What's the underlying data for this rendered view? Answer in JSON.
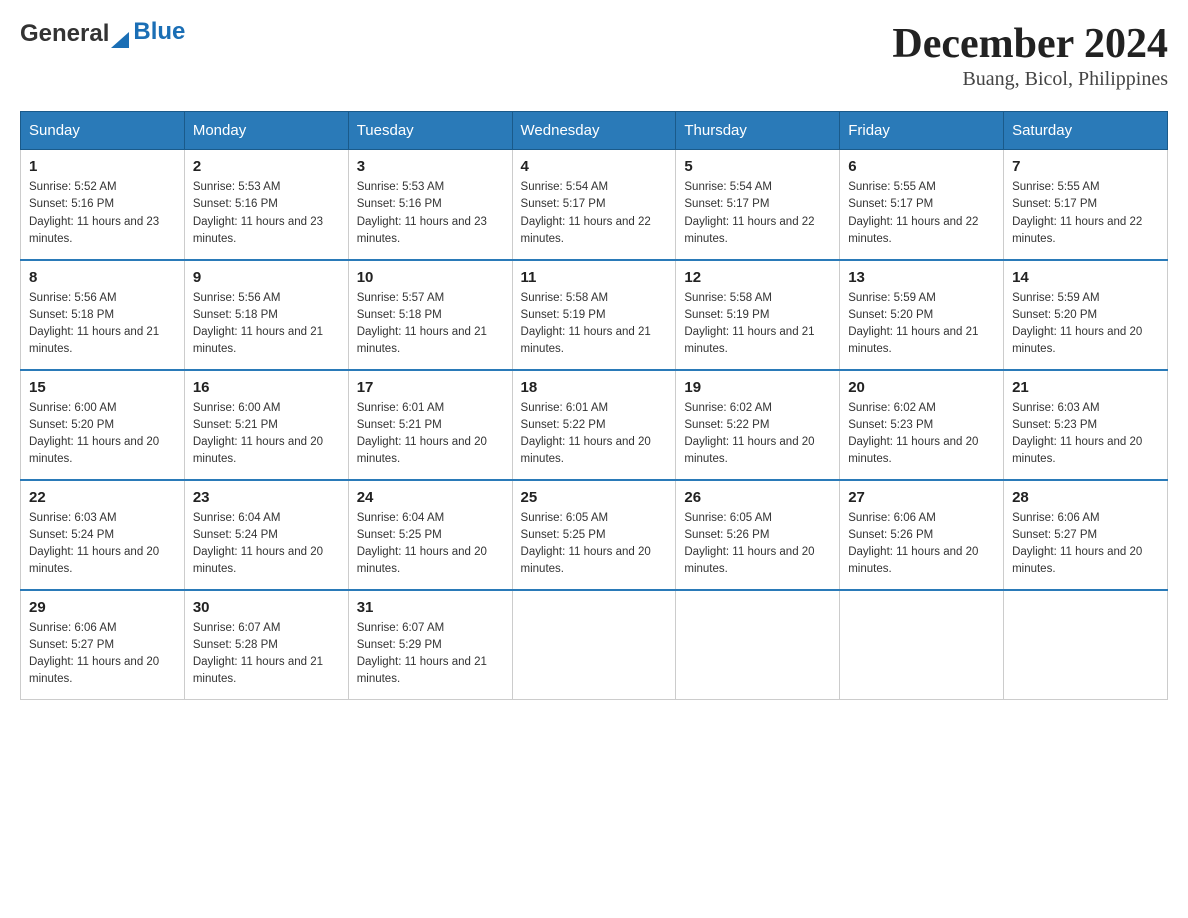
{
  "logo": {
    "text_general": "General",
    "text_blue": "Blue"
  },
  "header": {
    "month": "December 2024",
    "location": "Buang, Bicol, Philippines"
  },
  "days_of_week": [
    "Sunday",
    "Monday",
    "Tuesday",
    "Wednesday",
    "Thursday",
    "Friday",
    "Saturday"
  ],
  "weeks": [
    [
      {
        "day": "1",
        "sunrise": "5:52 AM",
        "sunset": "5:16 PM",
        "daylight": "11 hours and 23 minutes."
      },
      {
        "day": "2",
        "sunrise": "5:53 AM",
        "sunset": "5:16 PM",
        "daylight": "11 hours and 23 minutes."
      },
      {
        "day": "3",
        "sunrise": "5:53 AM",
        "sunset": "5:16 PM",
        "daylight": "11 hours and 23 minutes."
      },
      {
        "day": "4",
        "sunrise": "5:54 AM",
        "sunset": "5:17 PM",
        "daylight": "11 hours and 22 minutes."
      },
      {
        "day": "5",
        "sunrise": "5:54 AM",
        "sunset": "5:17 PM",
        "daylight": "11 hours and 22 minutes."
      },
      {
        "day": "6",
        "sunrise": "5:55 AM",
        "sunset": "5:17 PM",
        "daylight": "11 hours and 22 minutes."
      },
      {
        "day": "7",
        "sunrise": "5:55 AM",
        "sunset": "5:17 PM",
        "daylight": "11 hours and 22 minutes."
      }
    ],
    [
      {
        "day": "8",
        "sunrise": "5:56 AM",
        "sunset": "5:18 PM",
        "daylight": "11 hours and 21 minutes."
      },
      {
        "day": "9",
        "sunrise": "5:56 AM",
        "sunset": "5:18 PM",
        "daylight": "11 hours and 21 minutes."
      },
      {
        "day": "10",
        "sunrise": "5:57 AM",
        "sunset": "5:18 PM",
        "daylight": "11 hours and 21 minutes."
      },
      {
        "day": "11",
        "sunrise": "5:58 AM",
        "sunset": "5:19 PM",
        "daylight": "11 hours and 21 minutes."
      },
      {
        "day": "12",
        "sunrise": "5:58 AM",
        "sunset": "5:19 PM",
        "daylight": "11 hours and 21 minutes."
      },
      {
        "day": "13",
        "sunrise": "5:59 AM",
        "sunset": "5:20 PM",
        "daylight": "11 hours and 21 minutes."
      },
      {
        "day": "14",
        "sunrise": "5:59 AM",
        "sunset": "5:20 PM",
        "daylight": "11 hours and 20 minutes."
      }
    ],
    [
      {
        "day": "15",
        "sunrise": "6:00 AM",
        "sunset": "5:20 PM",
        "daylight": "11 hours and 20 minutes."
      },
      {
        "day": "16",
        "sunrise": "6:00 AM",
        "sunset": "5:21 PM",
        "daylight": "11 hours and 20 minutes."
      },
      {
        "day": "17",
        "sunrise": "6:01 AM",
        "sunset": "5:21 PM",
        "daylight": "11 hours and 20 minutes."
      },
      {
        "day": "18",
        "sunrise": "6:01 AM",
        "sunset": "5:22 PM",
        "daylight": "11 hours and 20 minutes."
      },
      {
        "day": "19",
        "sunrise": "6:02 AM",
        "sunset": "5:22 PM",
        "daylight": "11 hours and 20 minutes."
      },
      {
        "day": "20",
        "sunrise": "6:02 AM",
        "sunset": "5:23 PM",
        "daylight": "11 hours and 20 minutes."
      },
      {
        "day": "21",
        "sunrise": "6:03 AM",
        "sunset": "5:23 PM",
        "daylight": "11 hours and 20 minutes."
      }
    ],
    [
      {
        "day": "22",
        "sunrise": "6:03 AM",
        "sunset": "5:24 PM",
        "daylight": "11 hours and 20 minutes."
      },
      {
        "day": "23",
        "sunrise": "6:04 AM",
        "sunset": "5:24 PM",
        "daylight": "11 hours and 20 minutes."
      },
      {
        "day": "24",
        "sunrise": "6:04 AM",
        "sunset": "5:25 PM",
        "daylight": "11 hours and 20 minutes."
      },
      {
        "day": "25",
        "sunrise": "6:05 AM",
        "sunset": "5:25 PM",
        "daylight": "11 hours and 20 minutes."
      },
      {
        "day": "26",
        "sunrise": "6:05 AM",
        "sunset": "5:26 PM",
        "daylight": "11 hours and 20 minutes."
      },
      {
        "day": "27",
        "sunrise": "6:06 AM",
        "sunset": "5:26 PM",
        "daylight": "11 hours and 20 minutes."
      },
      {
        "day": "28",
        "sunrise": "6:06 AM",
        "sunset": "5:27 PM",
        "daylight": "11 hours and 20 minutes."
      }
    ],
    [
      {
        "day": "29",
        "sunrise": "6:06 AM",
        "sunset": "5:27 PM",
        "daylight": "11 hours and 20 minutes."
      },
      {
        "day": "30",
        "sunrise": "6:07 AM",
        "sunset": "5:28 PM",
        "daylight": "11 hours and 21 minutes."
      },
      {
        "day": "31",
        "sunrise": "6:07 AM",
        "sunset": "5:29 PM",
        "daylight": "11 hours and 21 minutes."
      },
      null,
      null,
      null,
      null
    ]
  ]
}
